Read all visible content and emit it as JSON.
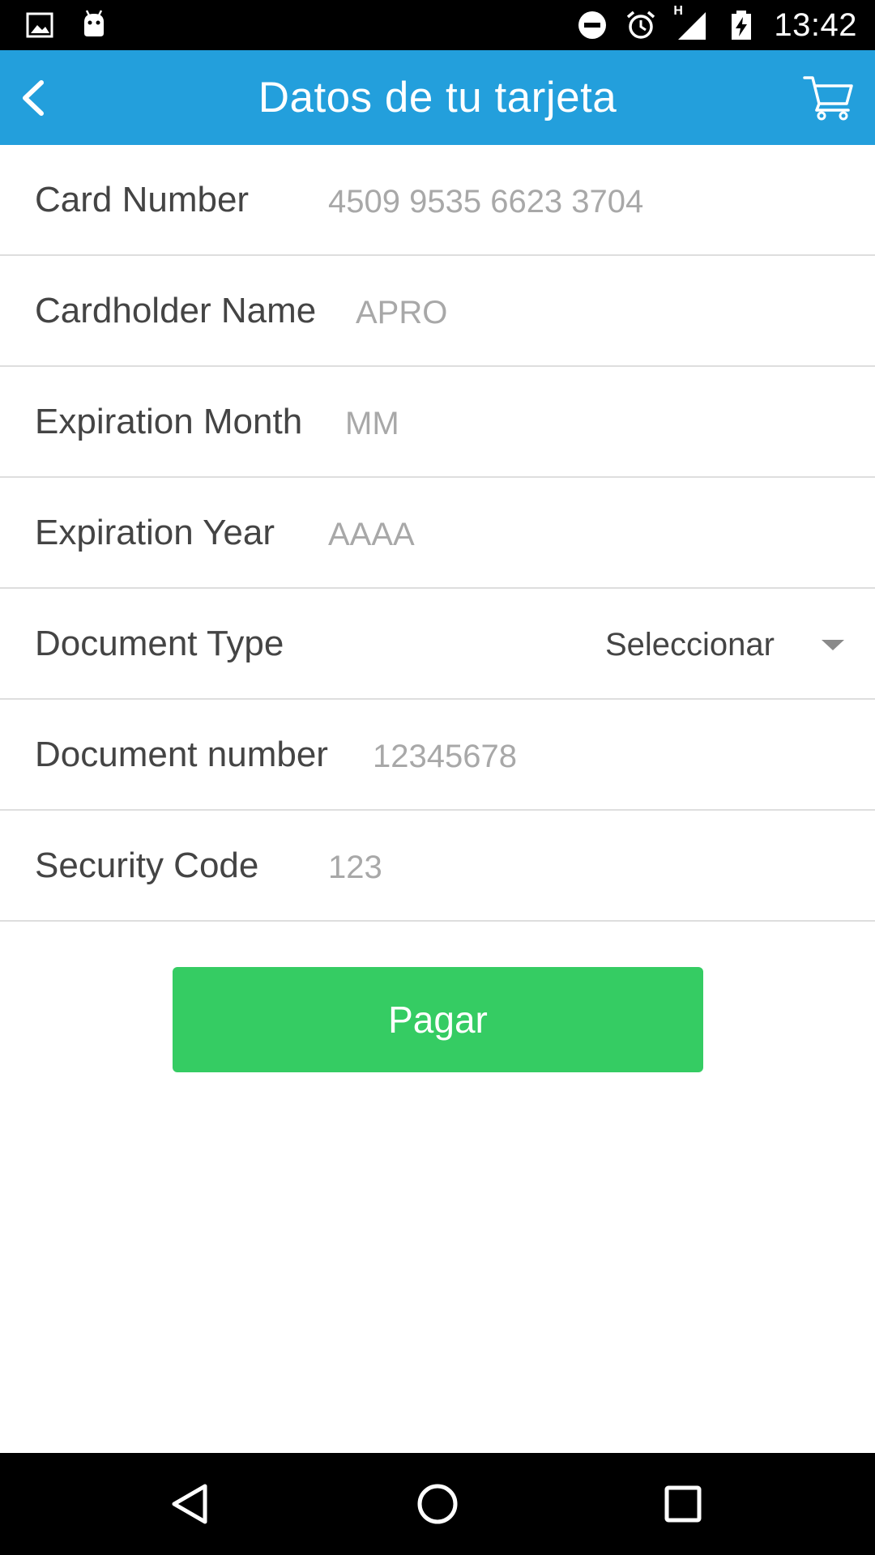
{
  "status_bar": {
    "time": "13:42",
    "network_letter": "H",
    "left_icons": [
      "image-icon",
      "android-icon"
    ],
    "right_icons": [
      "do-not-disturb-icon",
      "alarm-icon",
      "signal-icon",
      "battery-charging-icon"
    ]
  },
  "app_bar": {
    "title": "Datos de tu tarjeta",
    "back_icon": "chevron-left-icon",
    "cart_icon": "shopping-cart-icon",
    "color": "#239fdc"
  },
  "form": {
    "card_number": {
      "label": "Card Number",
      "placeholder": "4509 9535 6623 3704"
    },
    "cardholder_name": {
      "label": "Cardholder Name",
      "placeholder": "APRO"
    },
    "expiration_month": {
      "label": "Expiration Month",
      "placeholder": "MM"
    },
    "expiration_year": {
      "label": "Expiration Year",
      "placeholder": "AAAA"
    },
    "document_type": {
      "label": "Document Type",
      "selected": "Seleccionar"
    },
    "document_number": {
      "label": "Document number",
      "placeholder": "12345678"
    },
    "security_code": {
      "label": "Security Code",
      "placeholder": "123"
    }
  },
  "pay_button": {
    "label": "Pagar",
    "color": "#35cc63"
  },
  "nav_bar": {
    "icons": [
      "back-triangle-icon",
      "home-circle-icon",
      "recents-square-icon"
    ]
  }
}
